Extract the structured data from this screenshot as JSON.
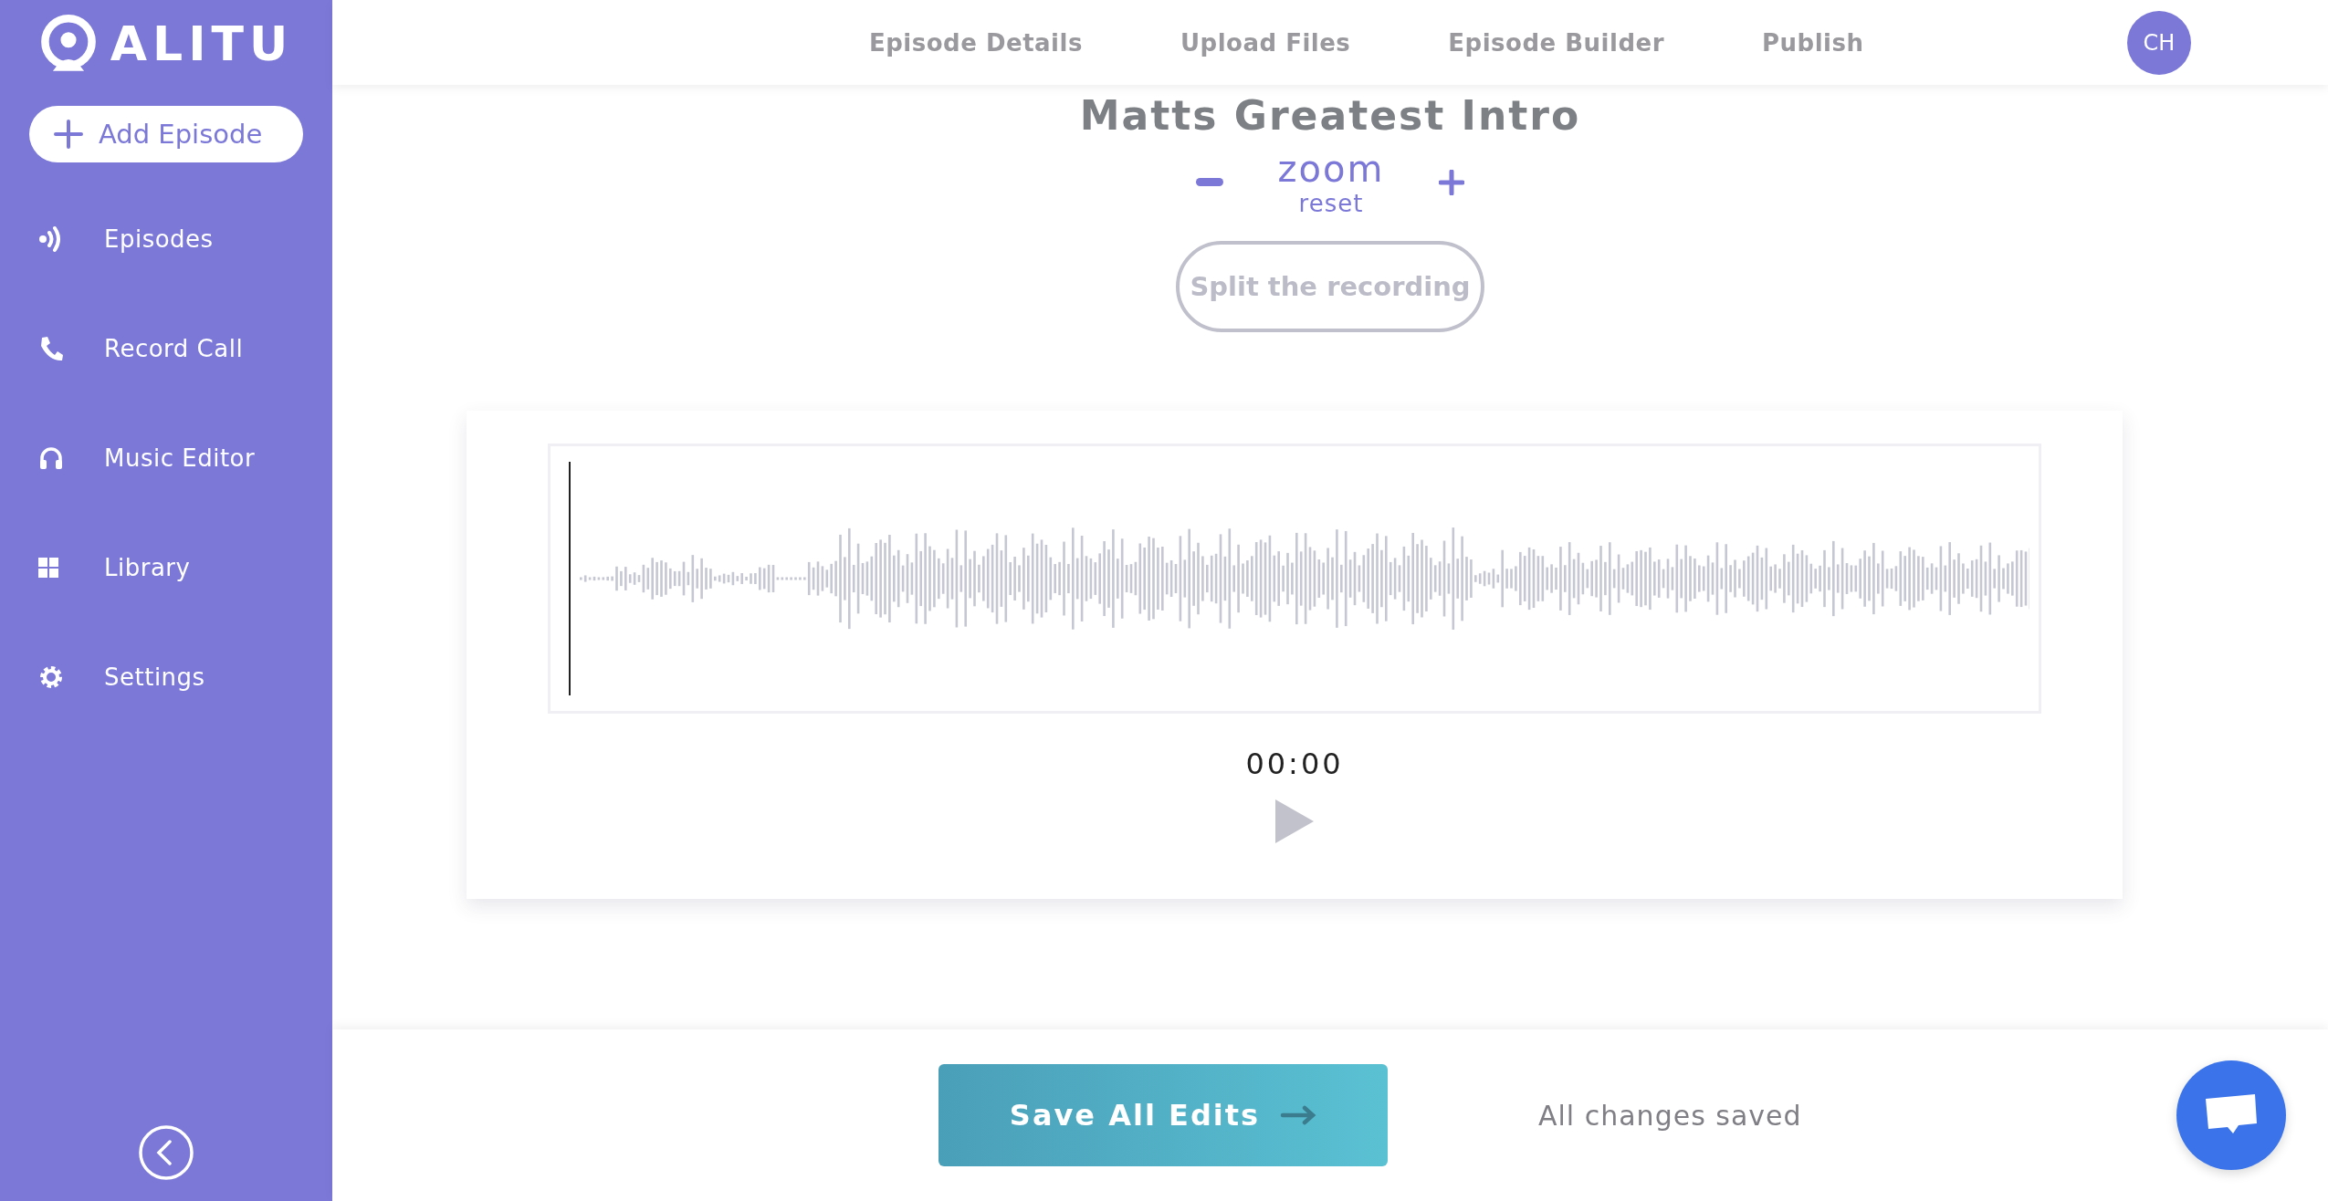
{
  "logo": {
    "text": "ALITU"
  },
  "add_episode": {
    "label": "Add Episode"
  },
  "sidebar": {
    "items": [
      {
        "label": "Episodes",
        "kind": "episodes"
      },
      {
        "label": "Record Call",
        "kind": "phone"
      },
      {
        "label": "Music Editor",
        "kind": "headphones"
      },
      {
        "label": "Library",
        "kind": "grid"
      },
      {
        "label": "Settings",
        "kind": "gear"
      }
    ]
  },
  "nav": {
    "items": [
      {
        "label": "Episode Details"
      },
      {
        "label": "Upload Files"
      },
      {
        "label": "Episode Builder"
      },
      {
        "label": "Publish"
      }
    ]
  },
  "avatar": {
    "initials": "CH"
  },
  "editor": {
    "title": "Matts Greatest Intro",
    "zoom_label": "zoom",
    "reset_label": "reset",
    "split_button": "Split the recording",
    "time": "00:00"
  },
  "footer": {
    "save_button": "Save All Edits",
    "status": "All changes saved"
  }
}
